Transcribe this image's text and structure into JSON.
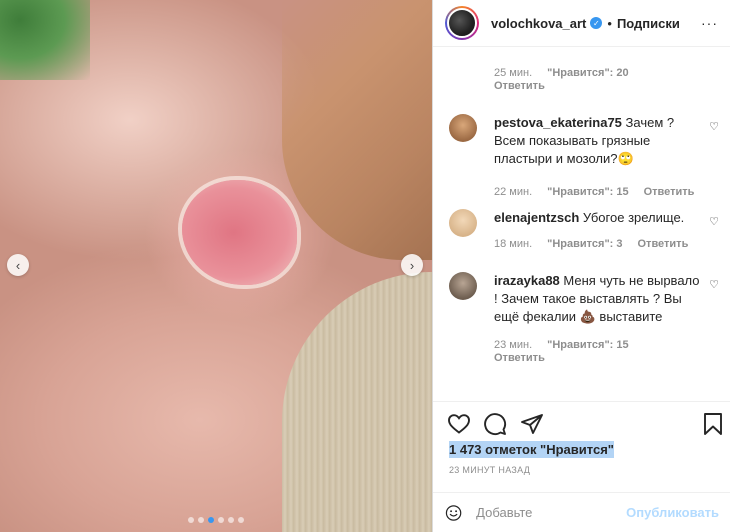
{
  "post": {
    "username": "volochkova_art",
    "follow_label": "Подписки",
    "separator": "•",
    "more_label": "···",
    "verified_glyph": "✓"
  },
  "photo": {
    "prev_glyph": "‹",
    "next_glyph": "›",
    "carousel_count": 6,
    "carousel_active": 2
  },
  "top_comment_meta": {
    "time": "25 мин.",
    "likes": "\"Нравится\": 20",
    "reply": "Ответить"
  },
  "comments": [
    {
      "username": "pestova_ekaterina75",
      "text": "Зачем ? Всем показывать грязные пластыри и мозоли?🙄",
      "time": "22 мин.",
      "likes": "\"Нравится\": 15",
      "reply": "Ответить",
      "avatar_color": "#b07a4f"
    },
    {
      "username": "elenajentzsch",
      "text": "Убогое зрелище.",
      "time": "18 мин.",
      "likes": "\"Нравится\": 3",
      "reply": "Ответить",
      "avatar_color": "#e8c9a0"
    },
    {
      "username": "irazayka88",
      "text": "Меня чуть не вырвало ! Зачем такое выставлять ? Вы ещё фекалии 💩 выставите",
      "time": "23 мин.",
      "likes": "\"Нравится\": 15",
      "reply": "Ответить",
      "avatar_color": "#8a7a6a"
    }
  ],
  "heart_glyph": "♡",
  "likes_total": "1 473 отметок \"Нравится\"",
  "post_time": "23 МИНУТ НАЗАД",
  "add_comment": {
    "placeholder": "Добавьте комментарий...",
    "placeholder_visible": "Добавьте",
    "publish_label": "Опубликовать"
  },
  "colors": {
    "accent": "#3897f0",
    "publish_disabled": "#b3dbff",
    "muted": "#8e8e8e",
    "likes_highlight": "#b3d4f5"
  }
}
